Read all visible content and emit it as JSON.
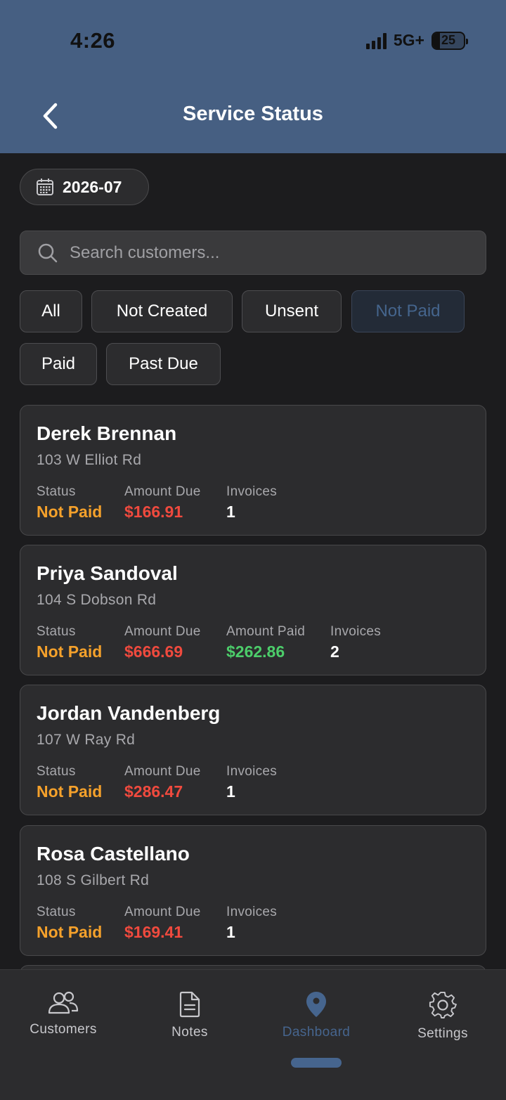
{
  "status_bar": {
    "time": "4:26",
    "network": "5G+",
    "battery": "25"
  },
  "header": {
    "title": "Service Status"
  },
  "month_picker": {
    "label": "2026-07"
  },
  "search": {
    "placeholder": "Search customers..."
  },
  "filters": [
    {
      "label": "All",
      "active": false
    },
    {
      "label": "Not Created",
      "active": false
    },
    {
      "label": "Unsent",
      "active": false
    },
    {
      "label": "Not Paid",
      "active": true
    },
    {
      "label": "Paid",
      "active": false
    },
    {
      "label": "Past Due",
      "active": false
    }
  ],
  "labels": {
    "status": "Status",
    "amount_due": "Amount Due",
    "amount_paid": "Amount Paid",
    "invoices": "Invoices"
  },
  "customers": [
    {
      "name": "Derek Brennan",
      "address": "103 W Elliot Rd",
      "status": "Not Paid",
      "amount_due": "$166.91",
      "invoices": "1"
    },
    {
      "name": "Priya Sandoval",
      "address": "104 S Dobson Rd",
      "status": "Not Paid",
      "amount_due": "$666.69",
      "amount_paid": "$262.86",
      "invoices": "2"
    },
    {
      "name": "Jordan Vandenberg",
      "address": "107 W Ray Rd",
      "status": "Not Paid",
      "amount_due": "$286.47",
      "invoices": "1"
    },
    {
      "name": "Rosa Castellano",
      "address": "108 S Gilbert Rd",
      "status": "Not Paid",
      "amount_due": "$169.41",
      "invoices": "1"
    }
  ],
  "tabbar": [
    {
      "label": "Customers",
      "icon": "users-icon",
      "active": false
    },
    {
      "label": "Notes",
      "icon": "document-icon",
      "active": false
    },
    {
      "label": "Dashboard",
      "icon": "location-pin-icon",
      "active": true
    },
    {
      "label": "Settings",
      "icon": "gear-icon",
      "active": false
    }
  ],
  "colors": {
    "header": "#465f82",
    "accent": "#46658e",
    "status_not_paid": "#f5a12b",
    "amount_due": "#f04a3e",
    "amount_paid": "#4ccd6a"
  }
}
